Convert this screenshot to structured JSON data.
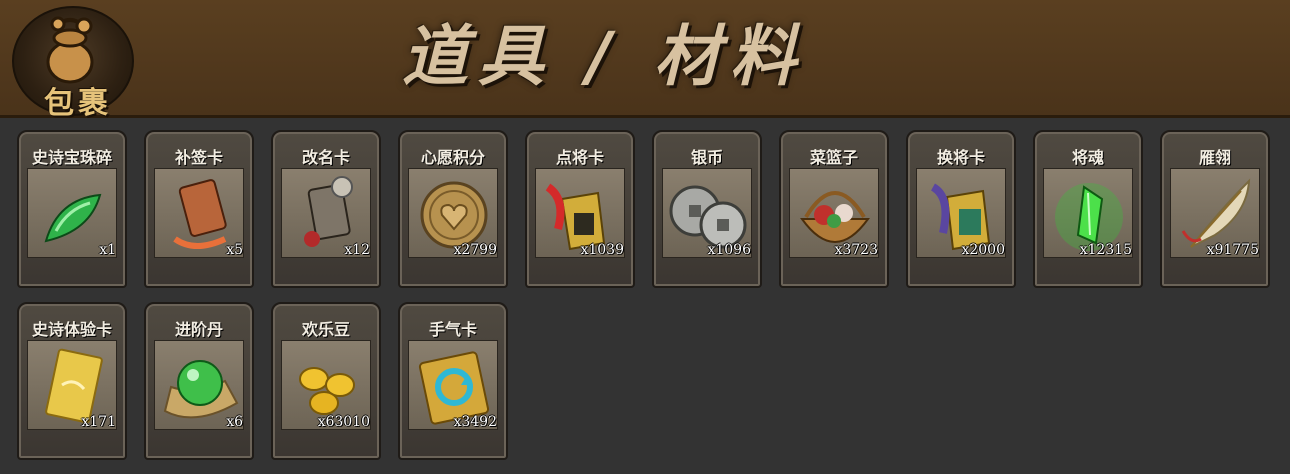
{
  "header": {
    "bag_label": "包裹",
    "title": "道具 / 材料",
    "title_color": "#d7c1a0"
  },
  "items": [
    {
      "name": "史诗宝珠碎",
      "count": "x1",
      "icon": "jade-shard-icon"
    },
    {
      "name": "补签卡",
      "count": "x5",
      "icon": "sign-in-tag-icon"
    },
    {
      "name": "改名卡",
      "count": "x12",
      "icon": "rename-tag-icon"
    },
    {
      "name": "心愿积分",
      "count": "x2799",
      "icon": "heart-coin-icon"
    },
    {
      "name": "点将卡",
      "count": "x1039",
      "icon": "general-token-icon"
    },
    {
      "name": "银币",
      "count": "x1096",
      "icon": "silver-coins-icon"
    },
    {
      "name": "菜篮子",
      "count": "x3723",
      "icon": "flower-basket-icon"
    },
    {
      "name": "换将卡",
      "count": "x2000",
      "icon": "swap-general-token-icon"
    },
    {
      "name": "将魂",
      "count": "x12315",
      "icon": "green-crystal-icon"
    },
    {
      "name": "雁翎",
      "count": "x91775",
      "icon": "feather-icon"
    },
    {
      "name": "史诗体验卡",
      "count": "x171",
      "icon": "gold-card-icon"
    },
    {
      "name": "进阶丹",
      "count": "x6",
      "icon": "green-orb-icon"
    },
    {
      "name": "欢乐豆",
      "count": "x63010",
      "icon": "gold-beans-icon"
    },
    {
      "name": "手气卡",
      "count": "x3492",
      "icon": "refresh-card-icon"
    }
  ]
}
